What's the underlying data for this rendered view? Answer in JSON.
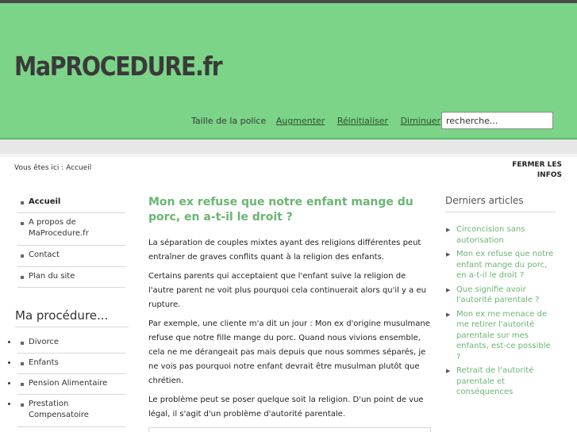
{
  "header": {
    "logo": "MaPROCEDURE.fr",
    "font_size_label": "Taille de la police",
    "font_links": [
      "Augmenter",
      "Réinitialiser",
      "Diminuer"
    ],
    "search_value": "recherche..."
  },
  "breadcrumb": "Vous êtes ici : Accueil",
  "close_info": "FERMER LES INFOS",
  "nav_main": [
    {
      "label": "Accueil"
    },
    {
      "label": "A propos de MaProcedure.fr"
    },
    {
      "label": "Contact"
    },
    {
      "label": "Plan du site"
    }
  ],
  "section_title": "Ma procédure...",
  "nav_proc": [
    {
      "label": "Divorce"
    },
    {
      "label": "Enfants"
    },
    {
      "label": "Pension Alimentaire"
    },
    {
      "label": "Prestation Compensatoire"
    }
  ],
  "article": {
    "title": "Mon ex refuse que notre enfant mange du porc, en a-t-il le droit ?",
    "paragraphs": [
      "La séparation de couples mixtes ayant des religions différentes peut entraîner de graves conflits quant à la religion des enfants.",
      "Certains parents qui acceptaient que l'enfant suive la religion de l'autre parent ne voit plus pourquoi cela continuerait alors qu'il y a eu rupture.",
      "Par exemple, une cliente m'a dit un jour : Mon ex d'origine musulmane refuse que notre fille mange du porc. Quand nous vivions ensemble, cela ne me dérangeait pas mais depuis que nous sommes séparés, je ne vois pas pourquoi  notre enfant devrait être musulman plutôt que chrétien.",
      "Le problème peut se poser quelque soit la religion. D'un point de vue légal, il s'agit d'un problème d'autorité parentale."
    ]
  },
  "latest": {
    "title": "Derniers articles",
    "items": [
      "Circoncision sans autorisation",
      "Mon ex refuse que notre enfant mange du porc, en a-t-il le droit ?",
      "Que signifie avoir l'autorité parentale ?",
      "Mon ex me menace de me retirer l'autorité parentale sur mes enfants, est-ce possible ?",
      "Retrait de l'autorité parentale et conséquences"
    ]
  }
}
